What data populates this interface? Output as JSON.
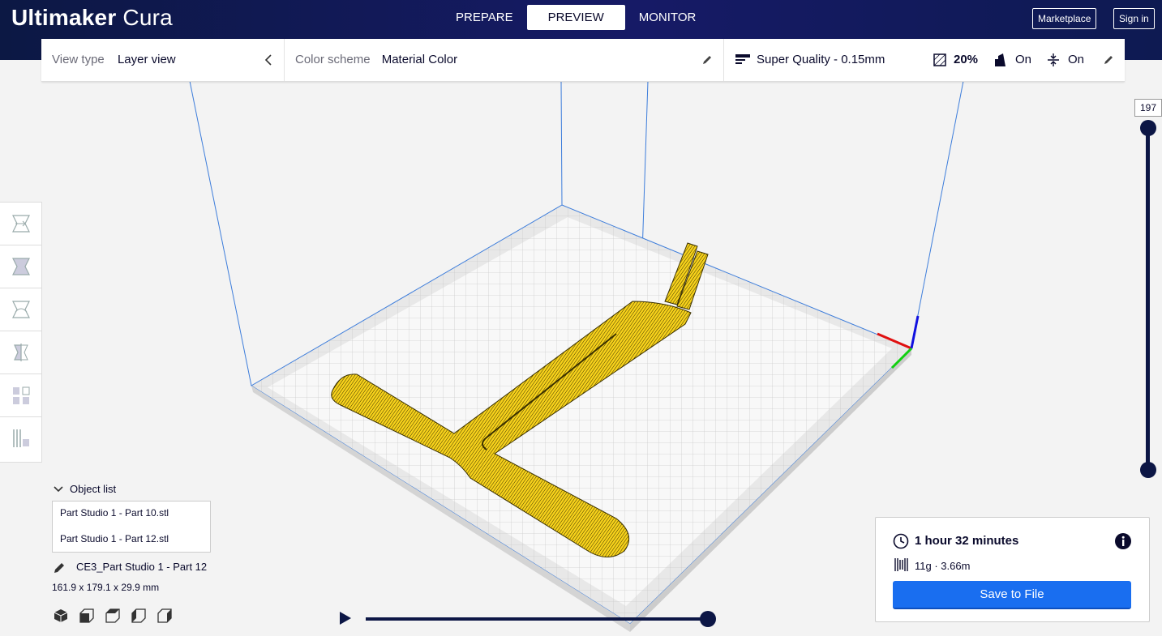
{
  "app": {
    "logo_bold": "Ultimaker",
    "logo_light": "Cura",
    "stages": [
      "PREPARE",
      "PREVIEW",
      "MONITOR"
    ],
    "active_stage": "PREVIEW",
    "marketplace_label": "Marketplace",
    "signin_label": "Sign in"
  },
  "header": {
    "view_type_label": "View type",
    "view_type_value": "Layer view",
    "color_scheme_label": "Color scheme",
    "color_scheme_value": "Material Color",
    "profile": "Super Quality - 0.15mm",
    "infill": "20%",
    "support": "On",
    "adhesion": "On"
  },
  "layer_slider": {
    "current_layer": "197"
  },
  "object_list": {
    "title": "Object list",
    "items": [
      "Part Studio 1 - Part 10.stl",
      "Part Studio 1 - Part 12.stl"
    ]
  },
  "selected": {
    "name": "CE3_Part Studio 1 - Part 12",
    "dimensions": "161.9 x 179.1 x 29.9 mm"
  },
  "print_info": {
    "time": "1 hour 32 minutes",
    "material": "11g · 3.66m",
    "save_label": "Save to File"
  },
  "colors": {
    "header_bg": "#161a66",
    "accent_blue": "#196ef0",
    "model_yellow": "#f7d21b",
    "slider_dark": "#0c1645"
  },
  "icons": [
    "clock-icon",
    "info-icon",
    "spool-icon",
    "pencil-icon",
    "infill-icon",
    "support-icon",
    "adhesion-icon",
    "play-icon",
    "chevron-left-icon",
    "chevron-down-icon"
  ]
}
